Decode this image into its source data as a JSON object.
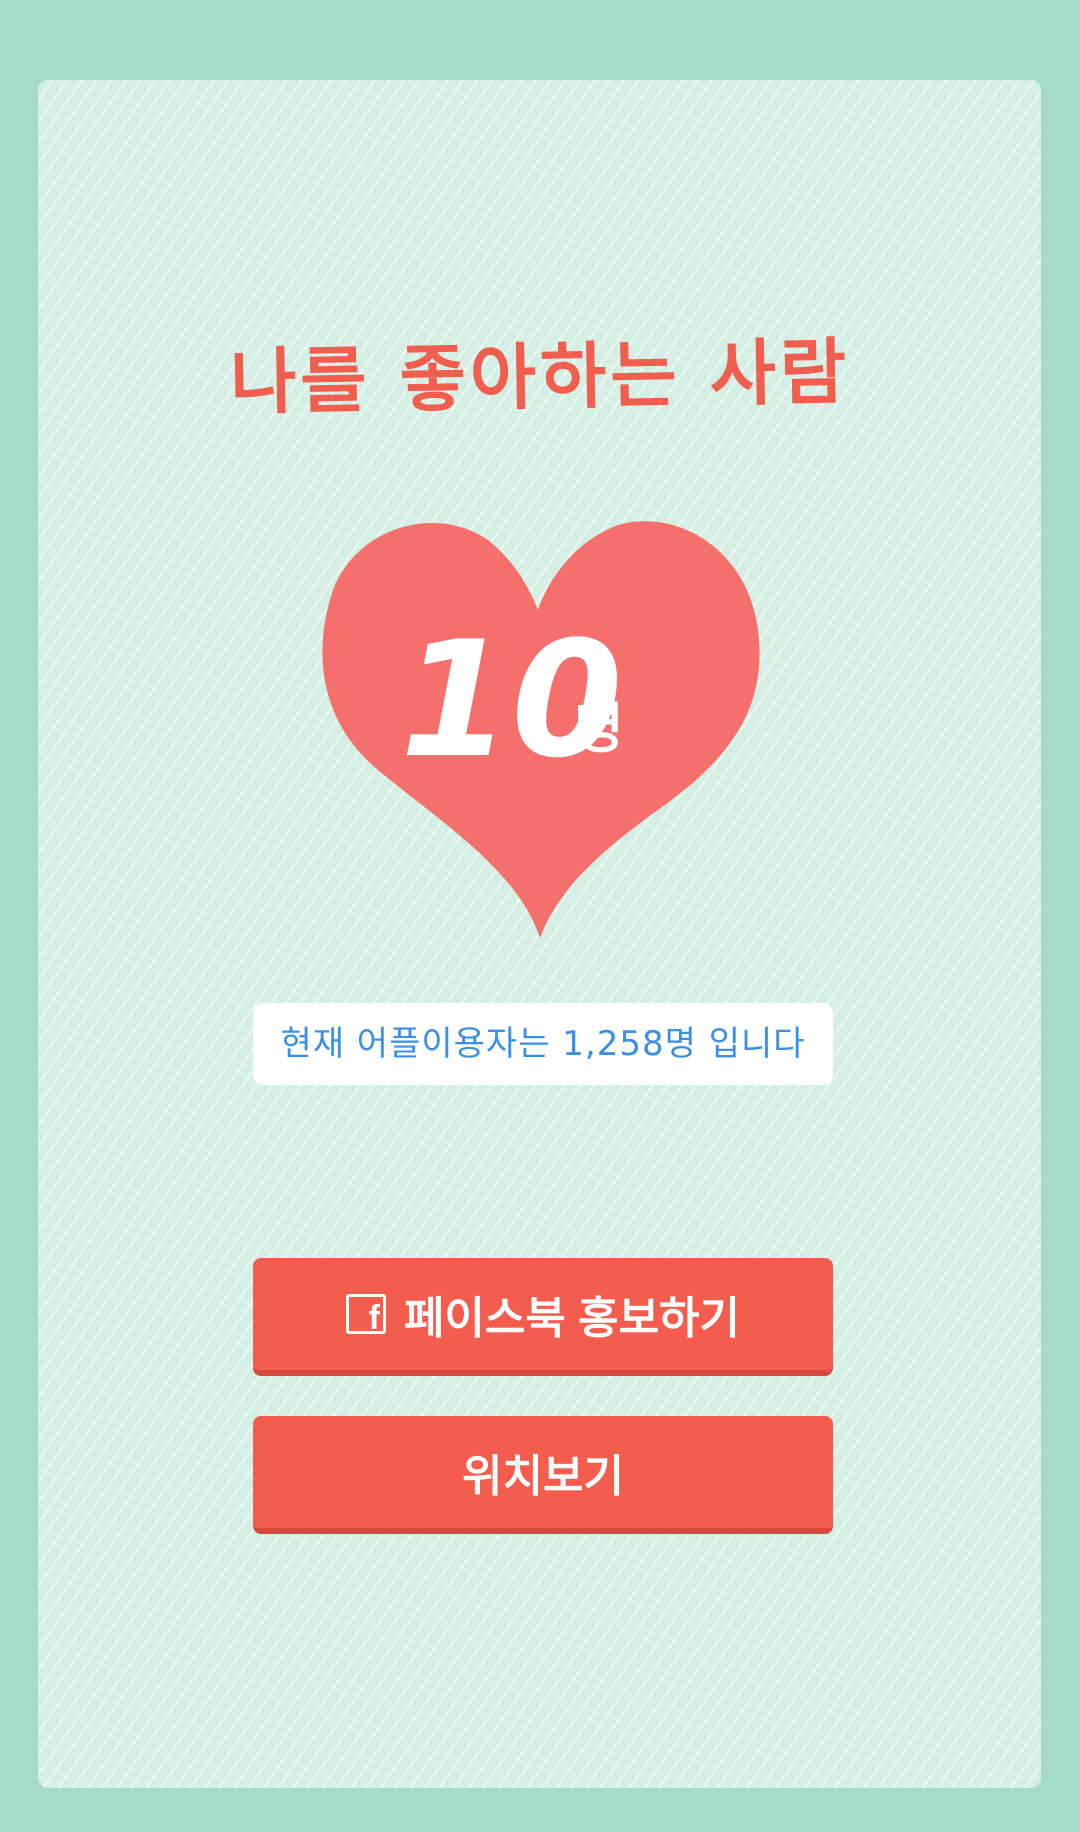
{
  "title": "나를 좋아하는 사람",
  "heart": {
    "count": "10",
    "unit": "명",
    "color": "#f5706c"
  },
  "info_text": "현재 어플이용자는 1,258명 입니다",
  "buttons": {
    "facebook_label": "페이스북 홍보하기",
    "facebook_icon": "f",
    "location_label": "위치보기"
  },
  "colors": {
    "background": "#a4dcc8",
    "panel": "#d5efe5",
    "accent": "#f45c4e",
    "info_text": "#3a8fe6"
  }
}
